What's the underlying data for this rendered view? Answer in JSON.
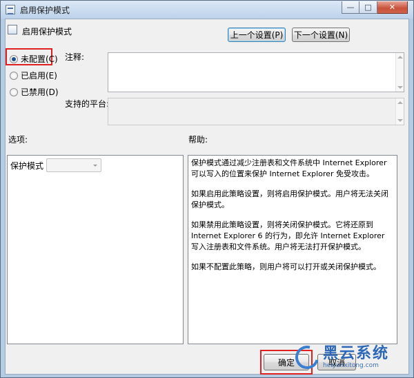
{
  "window": {
    "title": "启用保护模式",
    "minimize_symbol": "—",
    "maximize_symbol": "□",
    "close_symbol": "✕"
  },
  "header": {
    "policy_name": "启用保护模式",
    "prev_button": "上一个设置(P)",
    "next_button": "下一个设置(N)"
  },
  "state": {
    "options": [
      {
        "label": "未配置(C)",
        "checked": true
      },
      {
        "label": "已启用(E)",
        "checked": false
      },
      {
        "label": "已禁用(D)",
        "checked": false
      }
    ]
  },
  "comment": {
    "label": "注释:",
    "value": ""
  },
  "platform": {
    "label": "支持的平台:",
    "value": ""
  },
  "options_section": {
    "label": "选项:",
    "mode_label": "保护模式",
    "mode_value": ""
  },
  "help_section": {
    "label": "帮助:",
    "paragraphs": [
      "保护模式通过减少注册表和文件系统中 Internet Explorer 可以写入的位置来保护 Internet Explorer 免受攻击。",
      "如果启用此策略设置，则将启用保护模式。用户将无法关闭保护模式。",
      "如果禁用此策略设置，则将关闭保护模式。它将还原到 Internet Explorer 6 的行为，即允许 Internet Explorer 写入注册表和文件系统。用户将无法打开保护模式。",
      "如果不配置此策略，则用户将可以打开或关闭保护模式。"
    ]
  },
  "footer": {
    "ok_button": "确定",
    "cancel_button": "取消"
  },
  "watermark": {
    "title": "黑云系统",
    "url": "heiyunxitong.com"
  },
  "colors": {
    "highlight": "#e02020",
    "title_bar": "#c9dcef",
    "close_button": "#c9503a"
  }
}
